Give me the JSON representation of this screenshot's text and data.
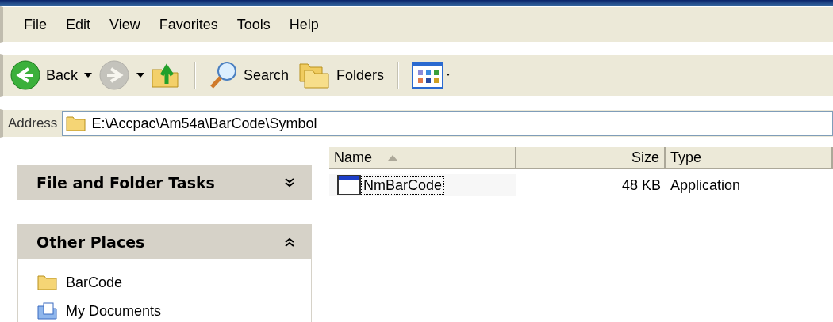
{
  "menu": [
    "File",
    "Edit",
    "View",
    "Favorites",
    "Tools",
    "Help"
  ],
  "toolbar": [
    {
      "kind": "back",
      "label": "Back",
      "disabled": false
    },
    {
      "kind": "forward",
      "disabled": true
    },
    {
      "kind": "up",
      "disabled": false
    },
    {
      "kind": "search",
      "label": "Search",
      "disabled": false
    },
    {
      "kind": "folders",
      "label": "Folders",
      "disabled": false
    },
    {
      "kind": "views",
      "disabled": false
    }
  ],
  "address": {
    "label": "Address",
    "value": "E:\\Accpac\\Am54a\\BarCode\\Symbol"
  },
  "panels": [
    {
      "title": "File and Folder Tasks",
      "expanded": false
    },
    {
      "title": "Other Places",
      "expanded": true,
      "items": [
        {
          "label": "BarCode",
          "kind": "folder"
        },
        {
          "label": "My Documents",
          "kind": "documents"
        }
      ]
    }
  ],
  "columns": [
    {
      "label": "Name",
      "sorted": true
    },
    {
      "label": "Size",
      "sorted": false
    },
    {
      "label": "Type",
      "sorted": false
    }
  ],
  "rows": [
    {
      "name": "NmBarCode",
      "size": "48 KB",
      "type": "Application",
      "focused": true
    }
  ]
}
